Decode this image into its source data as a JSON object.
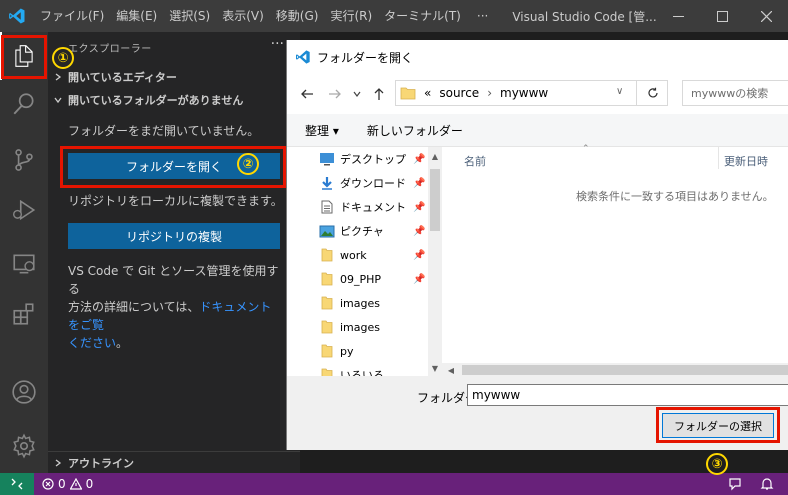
{
  "titlebar": {
    "menus": [
      "ファイル(F)",
      "編集(E)",
      "選択(S)",
      "表示(V)",
      "移動(G)",
      "実行(R)",
      "ターミナル(T)"
    ],
    "more": "···",
    "title": "Visual Studio Code [管..."
  },
  "sidebar": {
    "title": "エクスプローラー",
    "dots": "···",
    "section_open_editors": "開いているエディター",
    "section_no_folder": "開いているフォルダーがありません",
    "no_folder_text": "フォルダーをまだ開いていません。",
    "open_folder_button": "フォルダーを開く",
    "clone_text": "リポジトリをローカルに複製できます。",
    "clone_button": "リポジトリの複製",
    "git_text_1": "VS Code で Git とソース管理を使用する",
    "git_text_2": "方法の詳細については、",
    "git_link_1": "ドキュメントをご覧",
    "git_link_2": "ください",
    "git_text_end": "。",
    "outline": "アウトライン"
  },
  "annotations": {
    "one": "①",
    "two": "②",
    "three": "③"
  },
  "statusbar": {
    "errors": "0",
    "warnings": "0"
  },
  "dialog": {
    "title": "フォルダーを開く",
    "address": {
      "prefix": "«",
      "seg1": "source",
      "seg2": "mywww"
    },
    "search_placeholder": "mywwwの検索",
    "organize": "整理 ▾",
    "new_folder": "新しいフォルダー",
    "tree": [
      {
        "label": "デスクトップ",
        "icon": "desktop-icon",
        "pinned": true
      },
      {
        "label": "ダウンロード",
        "icon": "download-icon",
        "pinned": true
      },
      {
        "label": "ドキュメント",
        "icon": "document-icon",
        "pinned": true
      },
      {
        "label": "ピクチャ",
        "icon": "picture-icon",
        "pinned": true
      },
      {
        "label": "work",
        "icon": "folder-icon",
        "pinned": true
      },
      {
        "label": "09_PHP",
        "icon": "folder-icon",
        "pinned": true
      },
      {
        "label": "images",
        "icon": "folder-icon",
        "pinned": false
      },
      {
        "label": "images",
        "icon": "folder-icon",
        "pinned": false
      },
      {
        "label": "py",
        "icon": "folder-icon",
        "pinned": false
      },
      {
        "label": "いろいろ",
        "icon": "folder-icon",
        "pinned": false
      }
    ],
    "col_name": "名前",
    "col_date": "更新日時",
    "empty_message": "検索条件に一致する項目はありません。",
    "folder_label": "フォルダー:",
    "folder_value": "mywww",
    "select_button": "フォルダーの選択"
  },
  "colors": {
    "title_bar": "#3c3c3c",
    "activity_bar": "#333333",
    "sidebar": "#252526",
    "primary_button": "#0e639c",
    "status_bar": "#68217a",
    "remote": "#16825d",
    "highlight": "#e51400",
    "annotation": "#ffd800"
  }
}
